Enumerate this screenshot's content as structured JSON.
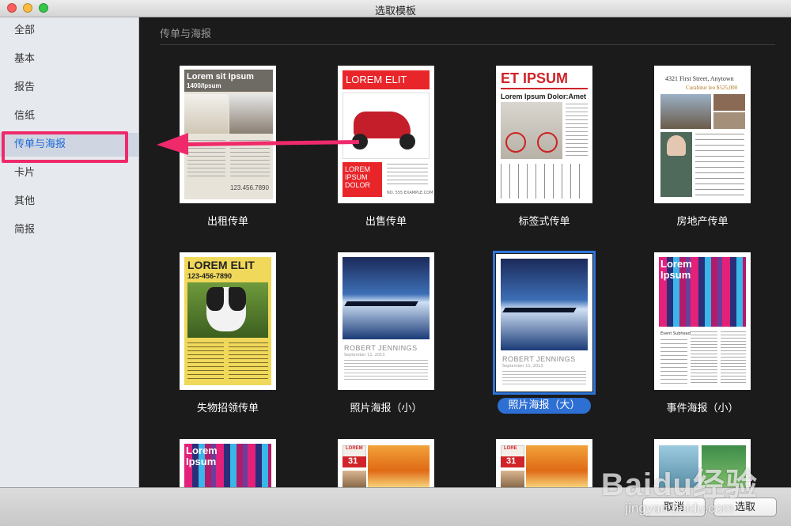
{
  "window": {
    "title": "选取模板"
  },
  "sidebar": {
    "items": [
      {
        "label": "全部",
        "selected": false
      },
      {
        "label": "基本",
        "selected": false
      },
      {
        "label": "报告",
        "selected": false
      },
      {
        "label": "信纸",
        "selected": false
      },
      {
        "label": "传单与海报",
        "selected": true
      },
      {
        "label": "卡片",
        "selected": false
      },
      {
        "label": "其他",
        "selected": false
      },
      {
        "label": "简报",
        "selected": false
      }
    ]
  },
  "main": {
    "section_title": "传单与海报",
    "templates": [
      {
        "label": "出租传单",
        "selected": false,
        "title": "Lorem sit Ipsum",
        "subtitle": "1400/Ipsum",
        "phone": "123.456.7890"
      },
      {
        "label": "出售传单",
        "selected": false,
        "title": "LOREM ELIT",
        "box_text": "LOREM IPSUM DOLOR",
        "url": "NO. 555 EXAMPLE.COM"
      },
      {
        "label": "标签式传单",
        "selected": false,
        "title": "ET IPSUM",
        "subtitle": "Lorem Ipsum Dolor:Amet"
      },
      {
        "label": "房地产传单",
        "selected": false,
        "title": "4321 First Street, Anytown",
        "subtitle": "Curabitur leo $525,000"
      },
      {
        "label": "失物招领传单",
        "selected": false,
        "title": "LOREM ELIT",
        "subtitle": "123-456-7890"
      },
      {
        "label": "照片海报（小）",
        "selected": false,
        "title": "ROBERT JENNINGS",
        "subtitle": "September 11, 2013"
      },
      {
        "label": "照片海报（大）",
        "selected": true,
        "title": "ROBERT JENNINGS",
        "subtitle": "September 11, 2013"
      },
      {
        "label": "事件海报（小）",
        "selected": false,
        "title": "Lorem Ipsum",
        "subtitle": "Event Subhead"
      },
      {
        "label": "",
        "selected": false,
        "title": "Lorem Ipsum"
      },
      {
        "label": "",
        "selected": false,
        "title": "LOREM",
        "number": "31"
      },
      {
        "label": "",
        "selected": false,
        "title": "LORE",
        "number": "31"
      },
      {
        "label": "",
        "selected": false,
        "title": ""
      }
    ]
  },
  "footer": {
    "cancel_label": "取消",
    "choose_label": "选取"
  },
  "watermark": {
    "brand": "Baidu经验",
    "url": "jingyan.baidu.com"
  },
  "colors": {
    "accent": "#2e6fd4",
    "highlight": "#ef2a6b",
    "sidebar_bg": "#e6e9ee",
    "main_bg": "#1b1b1b"
  },
  "icons": [
    "close-icon",
    "minimize-icon",
    "zoom-icon",
    "arrow-annotation-icon"
  ]
}
